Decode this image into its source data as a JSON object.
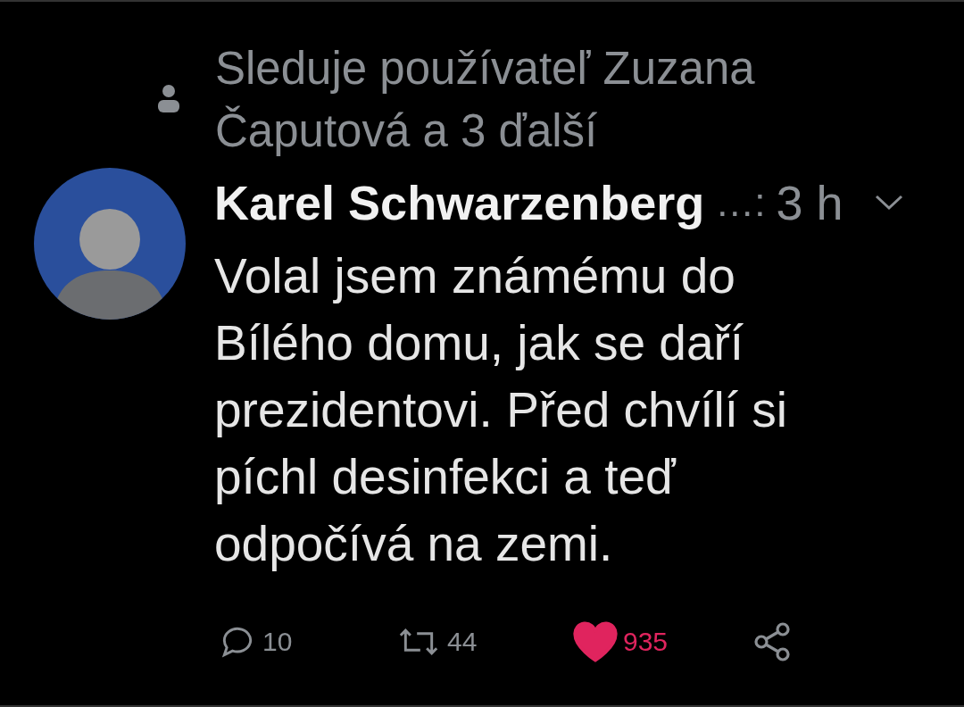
{
  "social_context": {
    "text": "Sleduje používateľ Zuzana Čaputová a 3 ďalší"
  },
  "tweet": {
    "author": "Karel Schwarzenberg",
    "ellipsis": "…:",
    "time": "3 h",
    "text": "Volal jsem známému do Bílého domu, jak se daří prezidentovi. Před chvílí si píchl desinfekci a teď odpočívá na zemi."
  },
  "actions": [
    {
      "kind": "reply",
      "count": "10",
      "selected": false
    },
    {
      "kind": "retweet",
      "count": "44",
      "selected": false
    },
    {
      "kind": "like",
      "count": "935",
      "selected": true
    },
    {
      "kind": "share",
      "selected": false
    }
  ]
}
